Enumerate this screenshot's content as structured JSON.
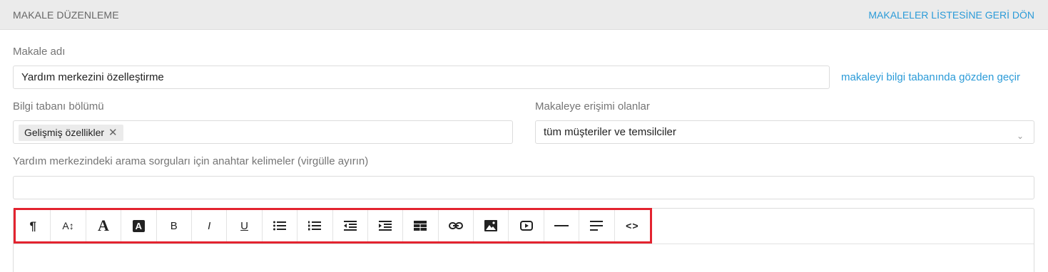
{
  "header": {
    "title": "MAKALE DÜZENLEME",
    "back_link": "MAKALELER LİSTESİNE GERİ DÖN"
  },
  "article_name": {
    "label": "Makale adı",
    "value": "Yardım merkezini özelleştirme",
    "review_link": "makaleyi bilgi tabanında gözden geçir"
  },
  "kb_section": {
    "label": "Bilgi tabanı bölümü",
    "tags": [
      "Gelişmiş özellikler"
    ]
  },
  "access": {
    "label": "Makaleye erişimi olanlar",
    "selected": "tüm müşteriler ve temsilciler"
  },
  "keywords": {
    "label": "Yardım merkezindeki arama sorguları için anahtar kelimeler (virgülle ayırın)",
    "value": ""
  },
  "toolbar": {
    "highlight_color": "#e3232f",
    "buttons": [
      {
        "icon": "paragraph-icon",
        "glyph": "¶"
      },
      {
        "icon": "font-size-icon",
        "glyph": "A↕"
      },
      {
        "icon": "text-color-icon",
        "glyph": "A"
      },
      {
        "icon": "background-color-icon",
        "glyph": "A"
      },
      {
        "icon": "bold-icon",
        "glyph": "B"
      },
      {
        "icon": "italic-icon",
        "glyph": "I"
      },
      {
        "icon": "underline-icon",
        "glyph": "U"
      },
      {
        "icon": "bulleted-list-icon",
        "glyph": ""
      },
      {
        "icon": "numbered-list-icon",
        "glyph": ""
      },
      {
        "icon": "outdent-icon",
        "glyph": ""
      },
      {
        "icon": "indent-icon",
        "glyph": ""
      },
      {
        "icon": "table-icon",
        "glyph": ""
      },
      {
        "icon": "link-icon",
        "glyph": ""
      },
      {
        "icon": "image-icon",
        "glyph": ""
      },
      {
        "icon": "video-icon",
        "glyph": ""
      },
      {
        "icon": "horizontal-rule-icon",
        "glyph": ""
      },
      {
        "icon": "align-icon",
        "glyph": ""
      },
      {
        "icon": "code-view-icon",
        "glyph": "<>"
      }
    ]
  },
  "colors": {
    "link": "#2b9bd8",
    "header_bg": "#ebebeb"
  }
}
